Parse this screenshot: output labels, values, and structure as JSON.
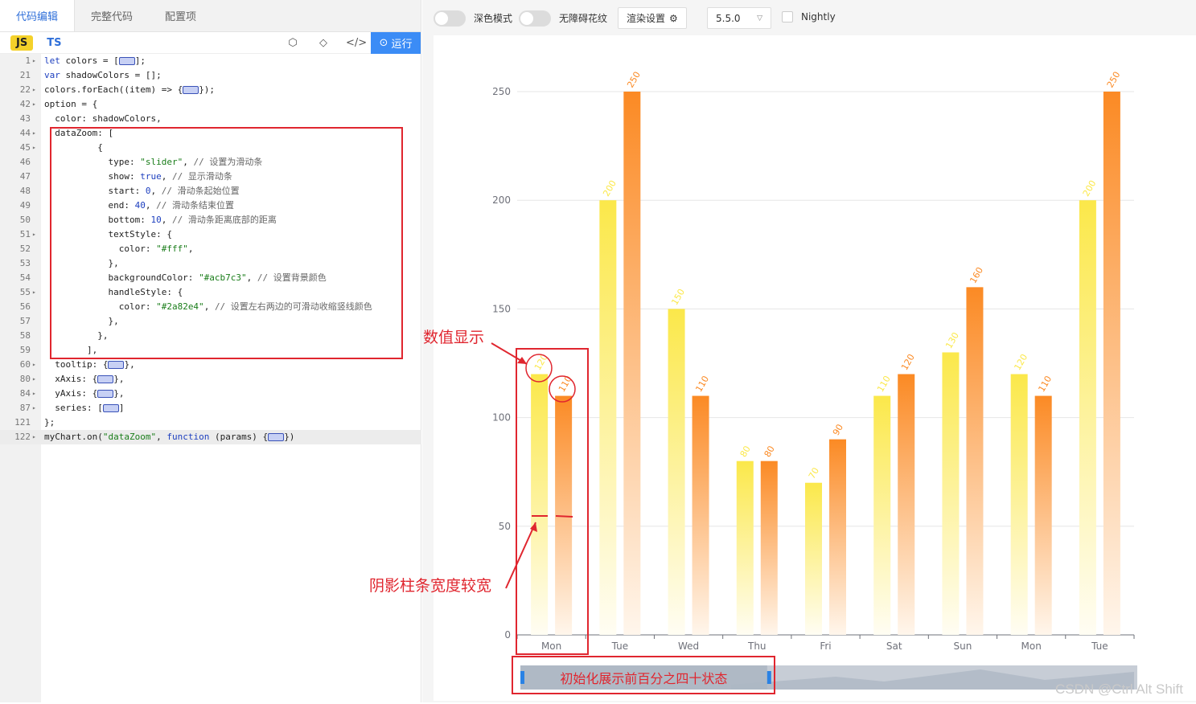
{
  "tabs": [
    "代码编辑",
    "完整代码",
    "配置项"
  ],
  "toolbar": {
    "js": "JS",
    "ts": "TS",
    "run": "运行"
  },
  "code_lines": [
    {
      "n": "1",
      "fold": true,
      "html": "<span class=\"kw\">let</span> colors = [<span class=\"foldmark\"></span>];"
    },
    {
      "n": "21",
      "fold": false,
      "html": "<span class=\"kw\">var</span> shadowColors = [];"
    },
    {
      "n": "22",
      "fold": true,
      "html": "colors.forEach((item) =&gt; {<span class=\"foldmark\"></span>});"
    },
    {
      "n": "42",
      "fold": true,
      "html": "option = {"
    },
    {
      "n": "43",
      "fold": false,
      "html": "  color: shadowColors,"
    },
    {
      "n": "44",
      "fold": true,
      "html": "  dataZoom: ["
    },
    {
      "n": "45",
      "fold": true,
      "html": "          {"
    },
    {
      "n": "46",
      "fold": false,
      "html": "            type: <span class=\"str\">\"slider\"</span>, <span class=\"cm\">// 设置为滑动条</span>"
    },
    {
      "n": "47",
      "fold": false,
      "html": "            show: <span class=\"kw\">true</span>, <span class=\"cm\">// 显示滑动条</span>"
    },
    {
      "n": "48",
      "fold": false,
      "html": "            start: <span class=\"num\">0</span>, <span class=\"cm\">// 滑动条起始位置</span>"
    },
    {
      "n": "49",
      "fold": false,
      "html": "            end: <span class=\"num\">40</span>, <span class=\"cm\">// 滑动条结束位置</span>"
    },
    {
      "n": "50",
      "fold": false,
      "html": "            bottom: <span class=\"num\">10</span>, <span class=\"cm\">// 滑动条距离底部的距离</span>"
    },
    {
      "n": "51",
      "fold": true,
      "html": "            textStyle: {"
    },
    {
      "n": "52",
      "fold": false,
      "html": "              color: <span class=\"str\">\"#fff\"</span>,"
    },
    {
      "n": "53",
      "fold": false,
      "html": "            },"
    },
    {
      "n": "54",
      "fold": false,
      "html": "            backgroundColor: <span class=\"str\">\"#acb7c3\"</span>, <span class=\"cm\">// 设置背景颜色</span>"
    },
    {
      "n": "55",
      "fold": true,
      "html": "            handleStyle: {"
    },
    {
      "n": "56",
      "fold": false,
      "html": "              color: <span class=\"str\">\"#2a82e4\"</span>, <span class=\"cm\">// 设置左右两边的可滑动收缩竖线颜色</span>"
    },
    {
      "n": "57",
      "fold": false,
      "html": "            },"
    },
    {
      "n": "58",
      "fold": false,
      "html": "          },"
    },
    {
      "n": "59",
      "fold": false,
      "html": "        ],"
    },
    {
      "n": "60",
      "fold": true,
      "html": "  tooltip: {<span class=\"foldmark\"></span>},"
    },
    {
      "n": "80",
      "fold": true,
      "html": "  xAxis: {<span class=\"foldmark\"></span>},"
    },
    {
      "n": "84",
      "fold": true,
      "html": "  yAxis: {<span class=\"foldmark\"></span>},"
    },
    {
      "n": "87",
      "fold": true,
      "html": "  series: [<span class=\"foldmark\"></span>]"
    },
    {
      "n": "121",
      "fold": false,
      "html": "};"
    },
    {
      "n": "122",
      "fold": true,
      "html": "myChart.on(<span class=\"str\">\"dataZoom\"</span>, <span class=\"kw\">function</span> (params) {<span class=\"foldmark\"></span>})"
    }
  ],
  "right_toolbar": {
    "dark_mode": "深色模式",
    "accessible": "无障碍花纹",
    "render_settings": "渲染设置",
    "version": "5.5.0",
    "nightly": "Nightly"
  },
  "annotations": {
    "value_display": "数值显示",
    "shadow_width": "阴影柱条宽度较宽",
    "initial_state": "初始化展示前百分之四十状态"
  },
  "watermark": "CSDN @Ctrl Alt Shift",
  "chart_data": {
    "type": "bar",
    "categories": [
      "Mon",
      "Tue",
      "Wed",
      "Thu",
      "Fri",
      "Sat",
      "Sun",
      "Mon",
      "Tue"
    ],
    "series": [
      {
        "values": [
          120,
          200,
          150,
          80,
          70,
          110,
          130,
          120,
          200
        ],
        "color_top": "#fbe84a",
        "color_bottom": "#fffdf3",
        "label_color": "#fbe84a"
      },
      {
        "values": [
          110,
          250,
          110,
          80,
          90,
          120,
          160,
          110,
          250
        ],
        "color_top": "#fb8a24",
        "color_bottom": "#fff6ec",
        "label_color": "#fb8a24"
      }
    ],
    "yticks": [
      0,
      50,
      100,
      150,
      200,
      250
    ],
    "ylim": [
      0,
      250
    ],
    "grid": true,
    "dataZoom": {
      "start": 0,
      "end": 40,
      "backgroundColor": "#acb7c3",
      "handleColor": "#2a82e4"
    }
  }
}
